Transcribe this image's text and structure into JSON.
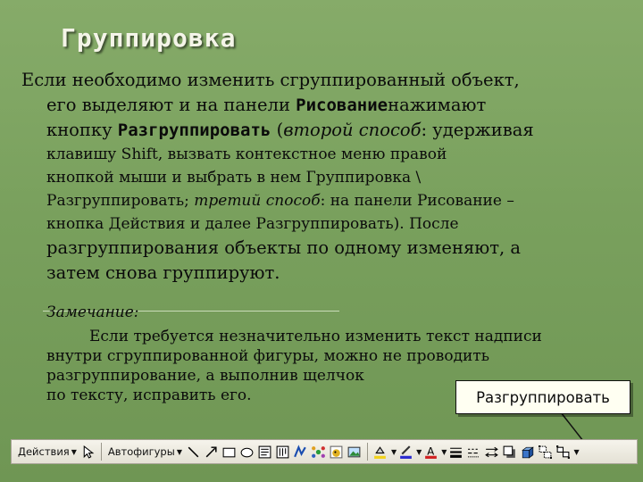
{
  "title": "Группировка",
  "paragraph": {
    "line1": "Если необходимо изменить сгруппированный объект,",
    "line2_a": "его выделяют и на панели ",
    "line2_b": "Рисование",
    "line2_c": "нажимают",
    "line3_a": "кнопку ",
    "line3_b": "Разгруппировать",
    "line3_c": " (",
    "line3_d": "второй способ",
    "line3_e": ": удерживая",
    "line4": "клавишу Shift, вызвать контекстное меню правой",
    "line5": "кнопкой мыши и выбрать в нем Группировка \\",
    "line6_a": "Разгруппировать; ",
    "line6_b": "третий способ",
    "line6_c": ": на панели Рисование –",
    "line7": "кнопка Действия и далее Разгруппировать). После",
    "line8": "разгруппирования объекты по одному изменяют, а",
    "line9": "затем снова группируют."
  },
  "note": {
    "label": "Замечание:",
    "line1": "Если требуется незначительно изменить текст надписи",
    "line2": "внутри сгруппированной фигуры, можно не проводить",
    "line3": "разгруппирование, а выполнив щелчок",
    "line4": "по тексту, исправить его."
  },
  "callout": {
    "text": "Разгруппировать"
  },
  "toolbar": {
    "actions_label": "Действия",
    "autoshapes_label": "Автофигуры",
    "icons": [
      "select-pointer",
      "line",
      "arrow",
      "rectangle",
      "oval",
      "text-box",
      "vertical-text",
      "wordart",
      "diagram",
      "clipart",
      "picture",
      "fill-color",
      "line-color",
      "font-color",
      "line-style",
      "dash-style",
      "arrow-style",
      "shadow",
      "3d",
      "ungroup"
    ]
  }
}
